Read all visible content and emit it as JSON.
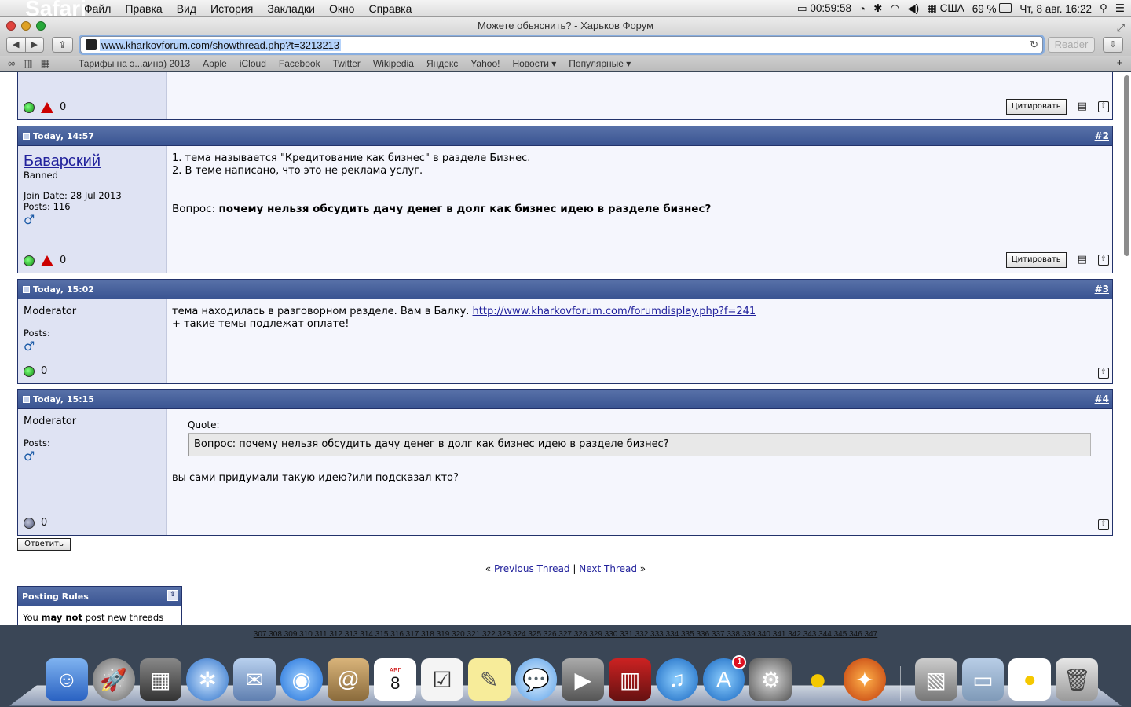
{
  "menubar": {
    "apple": "",
    "app_name": "Safari",
    "items": [
      "Файл",
      "Правка",
      "Вид",
      "История",
      "Закладки",
      "Окно",
      "Справка"
    ],
    "status": {
      "battery_time": "00:59:58",
      "input_source": "США",
      "battery_pct": "69 %",
      "datetime": "Чт, 8 авг.  16:22"
    }
  },
  "window": {
    "title": "Можете обьяснить? - Харьков Форум",
    "url": "www.kharkovforum.com/showthread.php?t=3213213",
    "reader_label": "Reader"
  },
  "bookmarks": [
    "Тарифы на э...аина) 2013",
    "Apple",
    "iCloud",
    "Facebook",
    "Twitter",
    "Wikipedia",
    "Яндекс",
    "Yahoo!",
    "Новости ▾",
    "Популярные ▾"
  ],
  "posts": [
    {
      "time": "Today, 14:57",
      "number": "#2",
      "username": "Баварский",
      "role": "Banned",
      "join_date": "Join Date: 28 Jul 2013",
      "posts": "Posts: 116",
      "line1": "1. тема называется \"Кредитование как бизнес\" в разделе Бизнес.",
      "line2": "2. В теме написано, что это не реклама услуг.",
      "question_label": "Вопрос: ",
      "question_bold": "почему нельзя обсудить дачу денег в долг как бизнес идею в разделе бизнес?",
      "quote_button": "Цитировать"
    },
    {
      "time": "Today, 15:02",
      "number": "#3",
      "role": "Moderator",
      "posts": "Posts:",
      "text_before_link": "тема находилась в разговорном разделе. Вам в Балку. ",
      "link": "http://www.kharkovforum.com/forumdisplay.php?f=241",
      "line2": "+ такие темы подлежат оплате!"
    },
    {
      "time": "Today, 15:15",
      "number": "#4",
      "role": "Moderator",
      "posts": "Posts:",
      "quote_label": "Quote:",
      "quote_text": "Вопрос: почему нельзя обсудить дачу денег в долг как бизнес идею в разделе бизнес?",
      "reply_text": "вы сами придумали такую идею?или подсказал кто?"
    }
  ],
  "top_post": {
    "quote_button": "Цитировать"
  },
  "reply_button": "Ответить",
  "thread_nav": {
    "prev": "Previous Thread",
    "next": "Next Thread"
  },
  "posting_rules": {
    "title": "Posting Rules",
    "line_pre": "You ",
    "line_bold": "may not",
    "line_post": " post new threads"
  },
  "page_numbers_row2": "307 308 309 310 311 312 313 314 315 316 317 318 319 320 321 322 323 324 325 326 327 328 329 330 331 332 333 334 335 336 337 338 339 340 341 342 343 344 345 346 347",
  "dock": {
    "calendar_day": "8",
    "calendar_month": "АВГ",
    "appstore_badge": "1"
  }
}
